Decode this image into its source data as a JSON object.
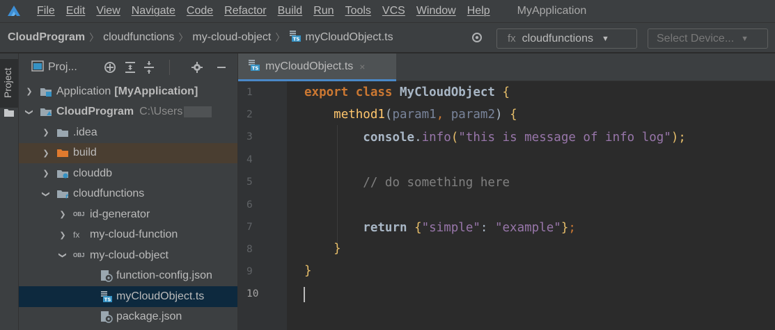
{
  "menubar": {
    "items": [
      "File",
      "Edit",
      "View",
      "Navigate",
      "Code",
      "Refactor",
      "Build",
      "Run",
      "Tools",
      "VCS",
      "Window",
      "Help"
    ],
    "app_title": "MyApplication"
  },
  "navbar": {
    "breadcrumbs": [
      "CloudProgram",
      "cloudfunctions",
      "my-cloud-object",
      "myCloudObject.ts"
    ],
    "function_select": {
      "prefix": "fx",
      "value": "cloudfunctions"
    },
    "device_select": {
      "value": "Select Device..."
    }
  },
  "stripe": {
    "tab_label": "Project"
  },
  "project": {
    "title": "Proj...",
    "tree": [
      {
        "label": "Application",
        "suffix": "[MyApplication]",
        "icon": "app-folder-icon",
        "expanded": false
      },
      {
        "label": "CloudProgram",
        "path_hint": "C:\\Users",
        "icon": "cloud-program-folder-icon",
        "expanded": true
      },
      {
        "label": ".idea",
        "icon": "folder-icon",
        "expanded": false
      },
      {
        "label": "build",
        "icon": "excluded-folder-icon",
        "expanded": false
      },
      {
        "label": "clouddb",
        "icon": "clouddb-folder-icon",
        "expanded": false
      },
      {
        "label": "cloudfunctions",
        "icon": "cloudfunctions-folder-icon",
        "expanded": true
      },
      {
        "label": "id-generator",
        "icon": "obj-icon",
        "expanded": false
      },
      {
        "label": "my-cloud-function",
        "icon": "fx-icon",
        "expanded": false
      },
      {
        "label": "my-cloud-object",
        "icon": "obj-icon",
        "expanded": true
      },
      {
        "label": "function-config.json",
        "icon": "json-file-icon"
      },
      {
        "label": "myCloudObject.ts",
        "icon": "ts-file-icon"
      },
      {
        "label": "package.json",
        "icon": "json-file-icon"
      }
    ]
  },
  "editor": {
    "tab": {
      "name": "myCloudObject.ts",
      "close": "×"
    },
    "line_numbers": [
      "1",
      "2",
      "3",
      "4",
      "5",
      "6",
      "7",
      "8",
      "9",
      "10"
    ],
    "lines": {
      "l1_kw1": "export",
      "l1_kw2": "class",
      "l1_name": "MyCloudObject",
      "l1_brace": "{",
      "l2_fn": "method1",
      "l2_open": "(",
      "l2_p1": "param1",
      "l2_comma": ", ",
      "l2_p2": "param2",
      "l2_close": ") ",
      "l2_brace": "{",
      "l3_obj": "console",
      "l3_dot": ".",
      "l3_mth": "info",
      "l3_open": "(",
      "l3_str": "\"this is message of info log\"",
      "l3_close": ");",
      "l5_comment": "// do something here",
      "l7_kw": "return",
      "l7_open": "{",
      "l7_k": "\"simple\"",
      "l7_colon": ": ",
      "l7_v": "\"example\"",
      "l7_close": "}",
      "l7_semi": ";",
      "l8_brace": "}",
      "l9_brace": "}"
    }
  },
  "colors": {
    "keyword": "#cc7832",
    "string": "#6a8759",
    "comment": "#808080",
    "function": "#ffc66d",
    "parameter": "#79849b",
    "method": "#9876aa",
    "selection": "#0d293e",
    "excluded": "#4a3e31"
  }
}
